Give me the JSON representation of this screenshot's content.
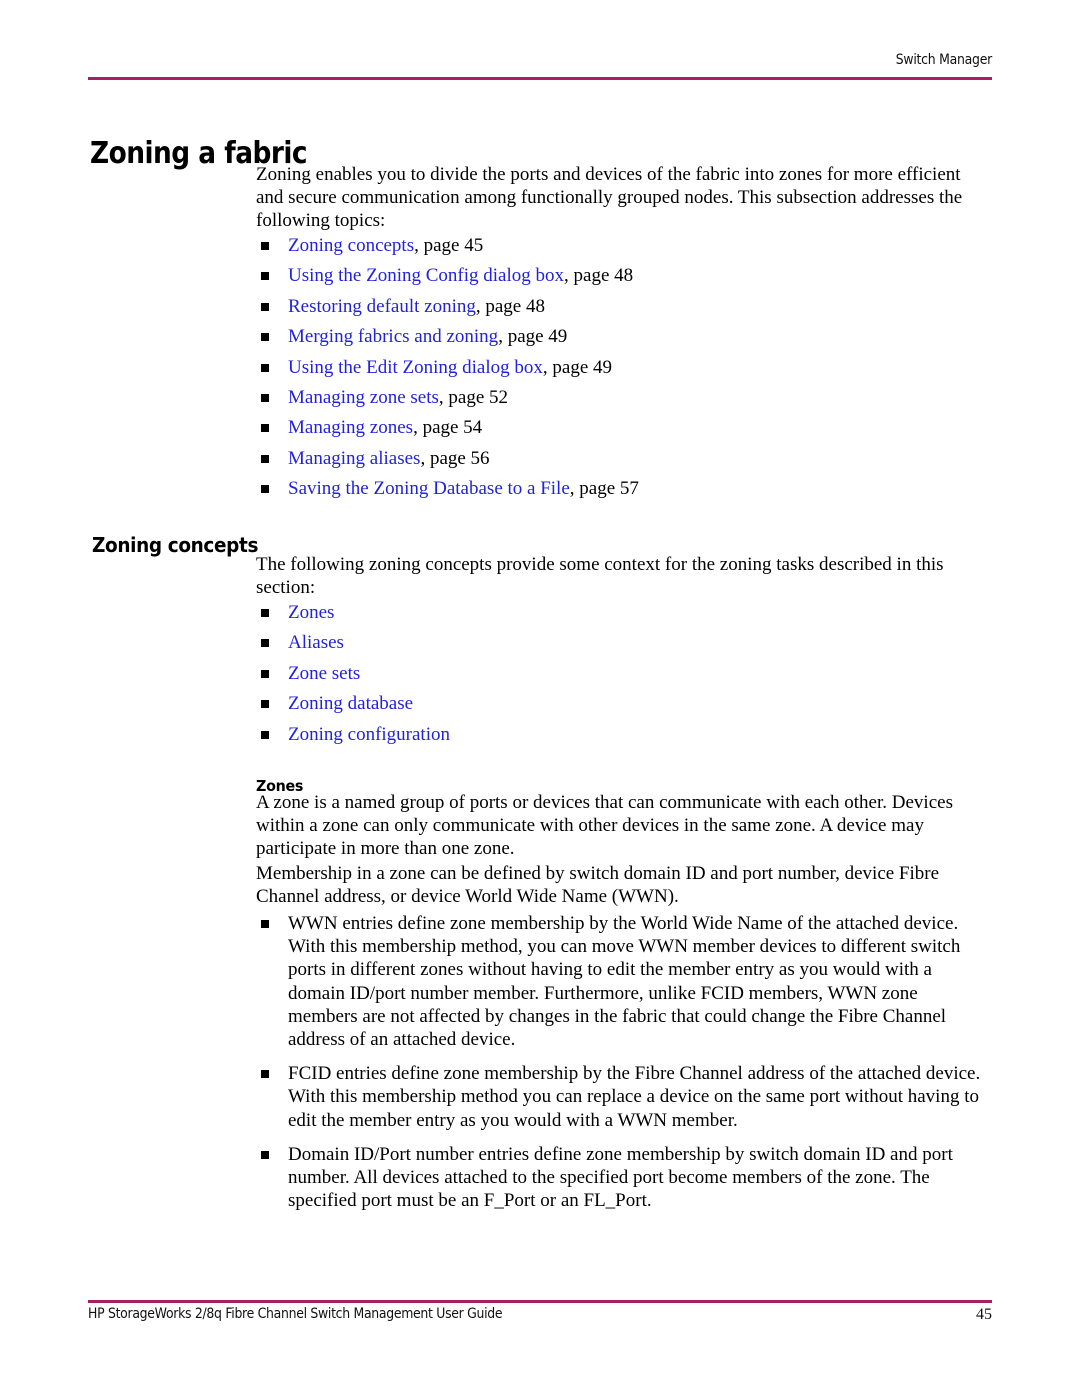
{
  "page": {
    "running_header": "Switch Manager",
    "rule_color": "#a61f62",
    "link_color": "#2222dd",
    "footer_title": "HP StorageWorks 2/8q Fibre Channel Switch Management User Guide",
    "footer_page_number": "45"
  },
  "section": {
    "title": "Zoning a fabric",
    "intro": "Zoning enables you to divide the ports and devices of the fabric into zones for more efficient and secure communication among functionally grouped nodes. This subsection addresses the following topics:",
    "toc": [
      {
        "link": "Zoning concepts",
        "tail": ", page 45"
      },
      {
        "link": "Using the Zoning Config dialog box",
        "tail": ", page 48"
      },
      {
        "link": "Restoring default zoning",
        "tail": ", page 48"
      },
      {
        "link": "Merging fabrics and zoning",
        "tail": ", page 49"
      },
      {
        "link": "Using the Edit Zoning dialog box",
        "tail": ", page 49"
      },
      {
        "link": "Managing zone sets",
        "tail": ", page 52"
      },
      {
        "link": "Managing zones",
        "tail": ", page 54"
      },
      {
        "link": "Managing aliases",
        "tail": ", page 56"
      },
      {
        "link": "Saving the Zoning Database to a File",
        "tail": ", page 57"
      }
    ]
  },
  "subsection": {
    "title": "Zoning concepts",
    "intro": "The following zoning concepts provide some context for the zoning tasks described in this section:",
    "concepts": [
      {
        "link": "Zones",
        "tail": ""
      },
      {
        "link": "Aliases",
        "tail": ""
      },
      {
        "link": "Zone sets",
        "tail": ""
      },
      {
        "link": "Zoning database",
        "tail": ""
      },
      {
        "link": "Zoning configuration",
        "tail": ""
      }
    ]
  },
  "zones": {
    "title": "Zones",
    "para1": "A zone is a named group of ports or devices that can communicate with each other. Devices within a zone can only communicate with other devices in the same zone. A device may participate in more than one zone.",
    "para2": "Membership in a zone can be defined by switch domain ID and port number, device Fibre Channel address, or device World Wide Name (WWN).",
    "bullets": [
      "WWN entries define zone membership by the World Wide Name of the attached device. With this membership method, you can move WWN member devices to different switch ports in different zones without having to edit the member entry as you would with a domain ID/port number member. Furthermore, unlike FCID members, WWN zone members are not affected by changes in the fabric that could change the Fibre Channel address of an attached device.",
      "FCID entries define zone membership by the Fibre Channel address of the attached device. With this membership method you can replace a device on the same port without having to edit the member entry as you would with a WWN member.",
      "Domain ID/Port number entries define zone membership by switch domain ID and port number. All devices attached to the specified port become members of the zone. The specified port must be an F_Port or an FL_Port."
    ]
  }
}
